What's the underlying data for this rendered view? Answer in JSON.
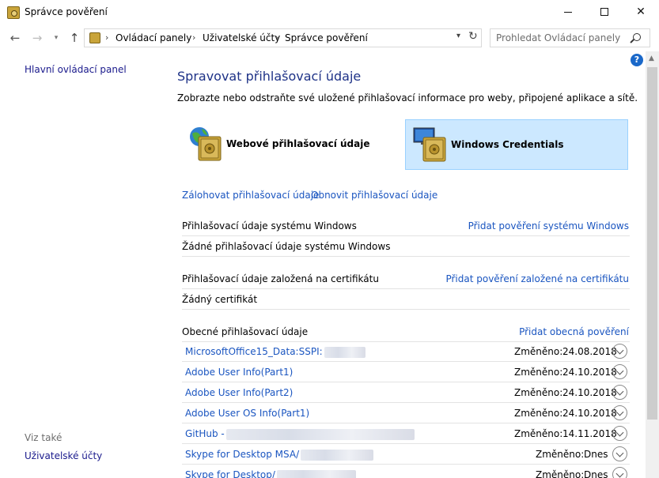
{
  "window": {
    "title": "Správce pověření",
    "minimize_icon": "minimize-icon",
    "maximize_icon": "maximize-icon",
    "close_label": "✕"
  },
  "nav": {
    "breadcrumbs": [
      "Ovládací panely",
      "Uživatelské účty",
      "Správce pověření"
    ],
    "search_placeholder": "Prohledat Ovládací panely"
  },
  "sidebar": {
    "home_link": "Hlavní ovládací panel",
    "see_also_label": "Viz také",
    "see_also_links": [
      "Uživatelské účty"
    ]
  },
  "main": {
    "title": "Spravovat přihlašovací údaje",
    "description": "Zobrazte nebo odstraňte své uložené přihlašovací informace pro weby, připojené aplikace a sítě.",
    "tiles": [
      {
        "label": "Webové přihlašovací údaje",
        "selected": false
      },
      {
        "label": "Windows Credentials",
        "selected": true
      }
    ],
    "backup_link": "Zálohovat přihlašovací údaje",
    "restore_link": "Obnovit přihlašovací údaje",
    "windows_section": {
      "heading": "Přihlašovací údaje systému Windows",
      "add_link": "Přidat pověření systému Windows",
      "empty_text": "Žádné přihlašovací údaje systému Windows"
    },
    "cert_section": {
      "heading": "Přihlašovací údaje založená na certifikátu",
      "add_link": "Přidat pověření založené na certifikátu",
      "empty_text": "Žádný certifikát"
    },
    "generic_section": {
      "heading": "Obecné přihlašovací údaje",
      "add_link": "Přidat obecná pověření",
      "modified_label": "Změněno:",
      "items": [
        {
          "name": "MicrosoftOffice15_Data:SSPI:",
          "date": "24.08.2018"
        },
        {
          "name": "Adobe User Info(Part1)",
          "date": "24.10.2018"
        },
        {
          "name": "Adobe User Info(Part2)",
          "date": "24.10.2018"
        },
        {
          "name": "Adobe User OS Info(Part1)",
          "date": "24.10.2018"
        },
        {
          "name": "GitHub -",
          "date": "14.11.2018"
        },
        {
          "name": "Skype for Desktop MSA/",
          "date": "Dnes"
        },
        {
          "name": "Skype for Desktop/",
          "date": "Dnes"
        }
      ]
    }
  },
  "colors": {
    "title_blue": "#1e3287",
    "link_blue": "#1a55c0",
    "selected_tile_bg": "#cce8ff",
    "help_blue": "#1a68c9"
  }
}
